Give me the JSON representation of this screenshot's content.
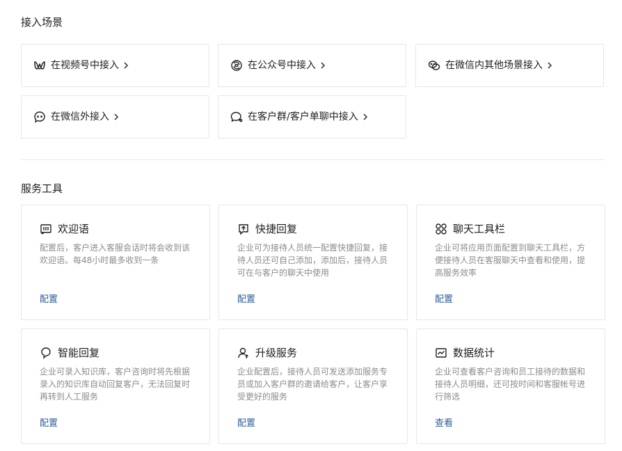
{
  "access": {
    "title": "接入场景",
    "items": [
      {
        "label": "在视频号中接入",
        "icon": "channels-icon"
      },
      {
        "label": "在公众号中接入",
        "icon": "official-account-icon"
      },
      {
        "label": "在微信内其他场景接入",
        "icon": "wechat-icon"
      },
      {
        "label": "在微信外接入",
        "icon": "chat-bubble-icon"
      },
      {
        "label": "在客户群/客户单聊中接入",
        "icon": "group-chat-icon"
      }
    ]
  },
  "tools": {
    "title": "服务工具",
    "items": [
      {
        "title": "欢迎语",
        "desc": "配置后，客户进入客服会话时将会收到该欢迎语。每48小时最多收到一条",
        "link": "配置",
        "icon": "welcome-message-icon"
      },
      {
        "title": "快捷回复",
        "desc": "企业可为接待人员统一配置快捷回复，接待人员还可自己添加，添加后，接待人员可在与客户的聊天中使用",
        "link": "配置",
        "icon": "quick-reply-icon"
      },
      {
        "title": "聊天工具栏",
        "desc": "企业可将应用页面配置到聊天工具栏，方便接待人员在客服聊天中查看和使用，提高服务效率",
        "link": "配置",
        "icon": "toolbar-grid-icon"
      },
      {
        "title": "智能回复",
        "desc": "企业可录入知识库，客户咨询时将先根据录入的知识库自动回复客户，无法回复时再转到人工服务",
        "link": "配置",
        "icon": "smart-reply-icon"
      },
      {
        "title": "升级服务",
        "desc": "企业配置后，接待人员可发送添加服务专员或加入客户群的邀请给客户，让客户享受更好的服务",
        "link": "配置",
        "icon": "upgrade-service-icon"
      },
      {
        "title": "数据统计",
        "desc": "企业可查看客户咨询和员工接待的数据和接待人员明细，还可按时间和客服帐号进行筛选",
        "link": "查看",
        "icon": "statistics-chart-icon"
      }
    ]
  }
}
